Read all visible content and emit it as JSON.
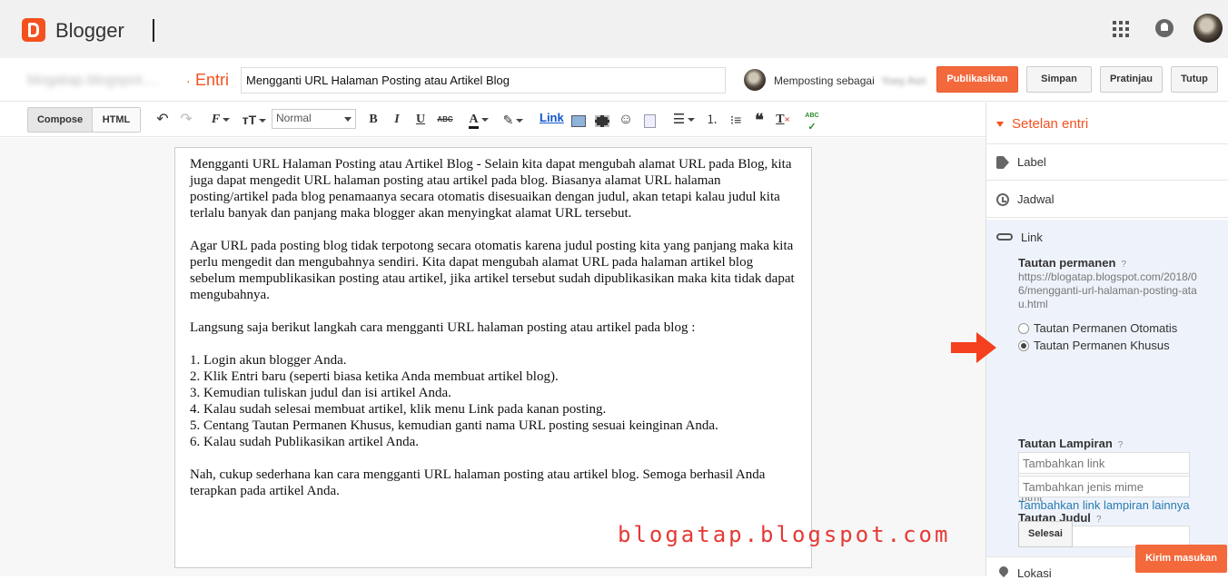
{
  "app": {
    "name": "Blogger",
    "accent": "#f4511e"
  },
  "header": {
    "apps_icon": "apps-grid-icon",
    "notifications_icon": "bell-icon",
    "avatar": "user-avatar"
  },
  "postbar": {
    "blog_name": "blogatap.blogspot....",
    "crumb": "Entri",
    "title_value": "Mengganti URL Halaman Posting atau Artikel Blog",
    "posting_as": "Memposting sebagai",
    "posting_name": "Yoey Asri",
    "buttons": {
      "publish": "Publikasikan",
      "save": "Simpan",
      "preview": "Pratinjau",
      "close": "Tutup"
    }
  },
  "toolbar": {
    "compose": "Compose",
    "html": "HTML",
    "font_size_value": "Normal",
    "bold": "B",
    "italic": "I",
    "underline": "U",
    "strike": "ABC",
    "text_color": "A",
    "link": "Link",
    "quote": "❝",
    "spell": "ABC"
  },
  "editor": {
    "paragraphs": [
      "Mengganti URL Halaman Posting atau Artikel Blog - Selain kita dapat mengubah alamat URL pada Blog, kita juga dapat mengedit URL halaman posting atau artikel pada blog. Biasanya alamat URL halaman posting/artikel pada blog penamaanya secara otomatis disesuaikan dengan judul, akan tetapi kalau judul kita terlalu banyak dan panjang maka blogger akan menyingkat alamat URL tersebut.",
      "Agar URL pada posting blog tidak terpotong secara otomatis karena judul posting kita yang panjang maka kita perlu mengedit dan mengubahnya sendiri. Kita dapat mengubah alamat URL pada halaman artikel blog sebelum mempublikasikan posting atau artikel, jika artikel tersebut sudah dipublikasikan maka kita tidak dapat mengubahnya.",
      "Langsung saja berikut langkah cara mengganti URL halaman posting atau artikel pada blog :"
    ],
    "steps": [
      "1. Login akun blogger Anda.",
      "2. Klik Entri baru (seperti biasa ketika Anda membuat artikel blog).",
      "3. Kemudian tuliskan judul dan isi artikel Anda.",
      "4. Kalau sudah selesai membuat artikel, klik menu Link pada kanan posting.",
      "5. Centang Tautan Permanen Khusus, kemudian ganti nama URL posting sesuai keinginan Anda.",
      "6. Kalau sudah Publikasikan artikel Anda."
    ],
    "closing": "Nah, cukup sederhana kan cara mengganti URL halaman posting atau artikel blog. Semoga berhasil Anda terapkan pada artikel Anda."
  },
  "watermark": "blogatap.blogspot.com",
  "sidebar": {
    "title": "Setelan entri",
    "label": "Label",
    "schedule": "Jadwal",
    "link": "Link",
    "permalink_label": "Tautan permanen",
    "help": "?",
    "permalink_url": "https://blogatap.blogspot.com/2018/06/mengganti-url-halaman-posting-atau.html",
    "radio_auto": "Tautan Permanen Otomatis",
    "radio_custom": "Tautan Permanen Khusus",
    "custom_value": "mengganti-url-halaman-posting",
    "suffix": ".html",
    "title_link_label": "Tautan Judul",
    "title_link_value": "",
    "attachment_label": "Tautan Lampiran",
    "attachment_link_placeholder": "Tambahkan link",
    "attachment_mime_placeholder": "Tambahkan jenis mime",
    "add_more": "Tambahkan link lampiran lainnya",
    "done": "Selesai",
    "location": "Lokasi"
  },
  "feedback": "Kirim masukan"
}
